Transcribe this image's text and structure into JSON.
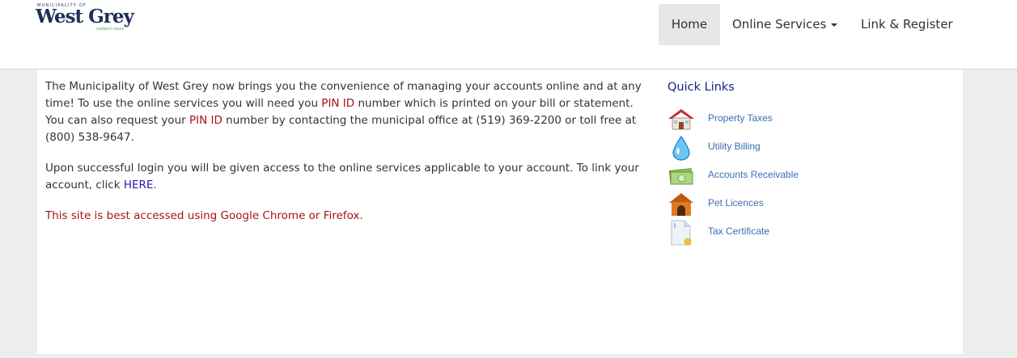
{
  "header": {
    "logo_small": "MUNICIPALITY OF",
    "logo_main": "West Grey",
    "logo_tagline": "nestled in nature",
    "nav": {
      "home": "Home",
      "online_services": "Online Services",
      "link_register": "Link & Register"
    }
  },
  "main": {
    "p1": {
      "before_pin1": "The Municipality of West Grey now brings you the convenience of managing your accounts online and at any time!  To use the online services you will need you ",
      "pin1": "PIN ID",
      "between_pins": " number which is printed on your bill or statement.  You can also request your ",
      "pin2": "PIN ID",
      "after_pin2": " number by contacting the municipal office at (519) 369-2200 or toll free at (800) 538-9647."
    },
    "p2": {
      "before_link": "Upon successful login you will be given access to the online services applicable to your account.  To link your account, click ",
      "link": "HERE",
      "after_link": "."
    },
    "browser_notice": "This site is best accessed using Google Chrome or Firefox."
  },
  "quick_links": {
    "title": "Quick Links",
    "items": [
      {
        "label": "Property Taxes",
        "icon": "house-icon"
      },
      {
        "label": "Utility Billing",
        "icon": "water-drop-icon"
      },
      {
        "label": "Accounts Receivable",
        "icon": "money-icon"
      },
      {
        "label": "Pet Licences",
        "icon": "doghouse-icon"
      },
      {
        "label": "Tax Certificate",
        "icon": "certificate-icon"
      }
    ]
  }
}
